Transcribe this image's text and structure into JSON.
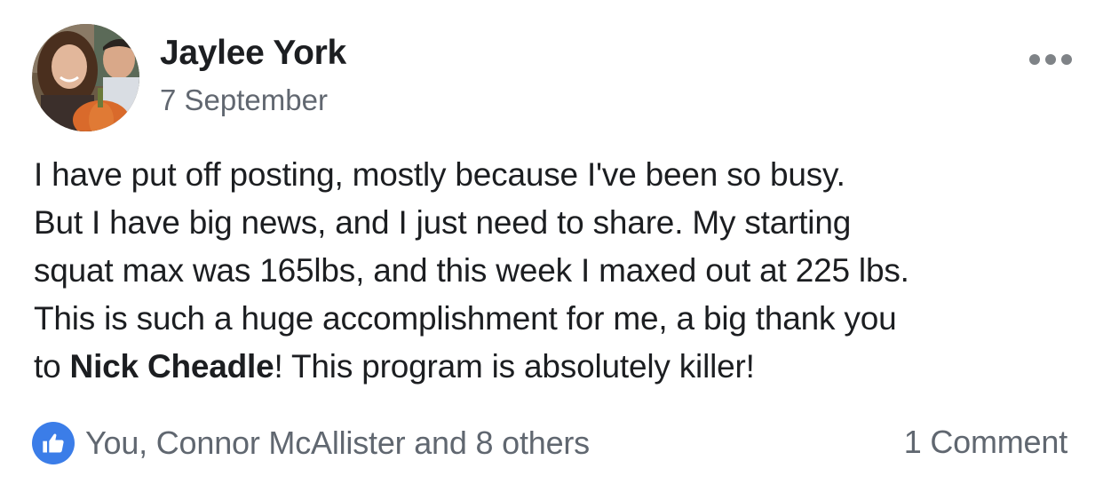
{
  "post": {
    "author": "Jaylee York",
    "date": "7 September",
    "more_icon": "more-horizontal-icon",
    "body_lines": [
      "I have put off posting, mostly because I've been so busy.",
      "But I have big news, and I just need to share. My starting",
      "squat max was 165lbs, and this week I maxed out at 225 lbs.",
      "This is such a huge accomplishment for me, a big thank you"
    ],
    "last_line": {
      "prefix": "to ",
      "mention": "Nick Cheadle",
      "suffix": "! This program is absolutely killer!"
    }
  },
  "footer": {
    "reaction_icon": "thumbs-up-icon",
    "reactions_text": "You, Connor McAllister and 8 others",
    "comments_text": "1 Comment"
  },
  "colors": {
    "like_blue": "#3b7de8",
    "secondary_text": "#606770",
    "primary_text": "#1c1e21"
  }
}
